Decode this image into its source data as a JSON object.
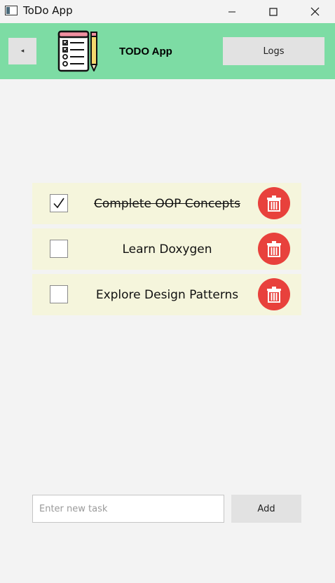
{
  "window": {
    "title": "ToDo App",
    "icons": [
      "app-window-icon",
      "minimize-icon",
      "maximize-icon",
      "close-icon"
    ]
  },
  "header": {
    "back_label": "◂",
    "title": "TODO App",
    "logs_label": "Logs",
    "logo_icon": "checklist-notepad-with-pencil-icon",
    "background": "#7ddca4"
  },
  "tasks": [
    {
      "label": "Complete OOP Concepts",
      "checked": true
    },
    {
      "label": "Learn Doxygen",
      "checked": false
    },
    {
      "label": "Explore Design Patterns",
      "checked": false
    }
  ],
  "task_row_background": "#f5f5dc",
  "delete_button_color": "#e8413c",
  "delete_icon": "trash-icon",
  "new_task": {
    "value": "",
    "placeholder": "Enter new task",
    "add_label": "Add"
  }
}
